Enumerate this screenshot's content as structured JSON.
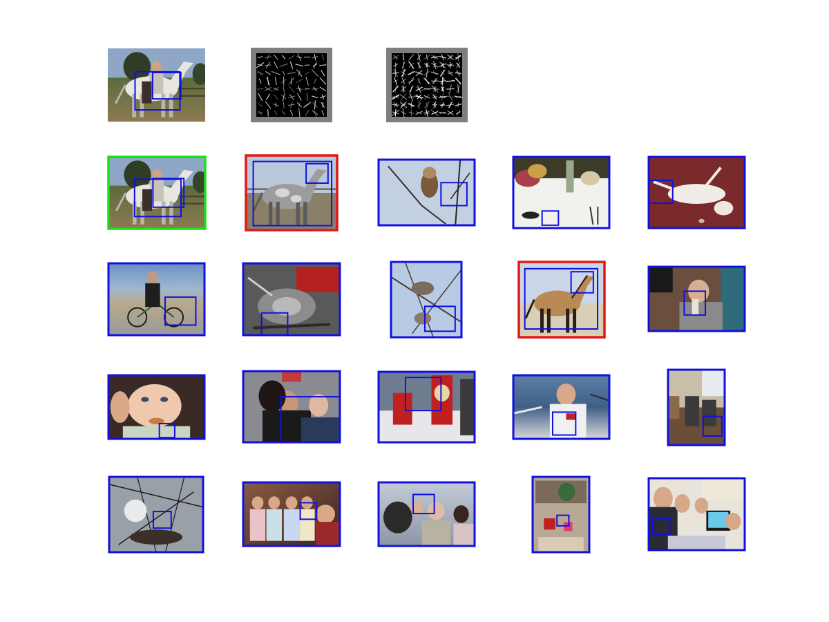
{
  "figure": {
    "background": "#ffffff",
    "colors": {
      "detection_box": "#1010e0",
      "frame_query": "#18e018",
      "frame_positive": "#e01818",
      "frame_negative": "#1010e0",
      "hog_background": "#7f7f7f",
      "hog_cell": "#000000",
      "hog_stroke": "#ffffff"
    },
    "query": {
      "image": {
        "scene": "rider-on-white-horse",
        "icon": "horse-rider-photo"
      },
      "hog_templates": [
        {
          "name": "hog-template-1",
          "icon": "hog-visualization"
        },
        {
          "name": "hog-template-2",
          "icon": "hog-visualization"
        }
      ]
    },
    "results": [
      {
        "scene": "rider-on-white-horse",
        "frame": "green"
      },
      {
        "scene": "grey-horse",
        "frame": "red"
      },
      {
        "scene": "owl-on-branch",
        "frame": "blue"
      },
      {
        "scene": "dining-table",
        "frame": "blue"
      },
      {
        "scene": "cat-on-carpet",
        "frame": "blue"
      },
      {
        "scene": "man-cycling-beach",
        "frame": "blue"
      },
      {
        "scene": "motorcycle-engine",
        "frame": "blue"
      },
      {
        "scene": "bird-nest",
        "frame": "blue"
      },
      {
        "scene": "brown-horse",
        "frame": "red"
      },
      {
        "scene": "man-drinking",
        "frame": "blue"
      },
      {
        "scene": "baby",
        "frame": "blue"
      },
      {
        "scene": "couple-portrait",
        "frame": "blue"
      },
      {
        "scene": "red-chairs",
        "frame": "blue"
      },
      {
        "scene": "man-on-boat",
        "frame": "blue"
      },
      {
        "scene": "dining-chairs",
        "frame": "blue"
      },
      {
        "scene": "heron-nest",
        "frame": "blue"
      },
      {
        "scene": "family-group",
        "frame": "blue"
      },
      {
        "scene": "elderly-people",
        "frame": "blue"
      },
      {
        "scene": "kitchen-clutter",
        "frame": "blue"
      },
      {
        "scene": "people-at-computer",
        "frame": "blue"
      }
    ]
  }
}
